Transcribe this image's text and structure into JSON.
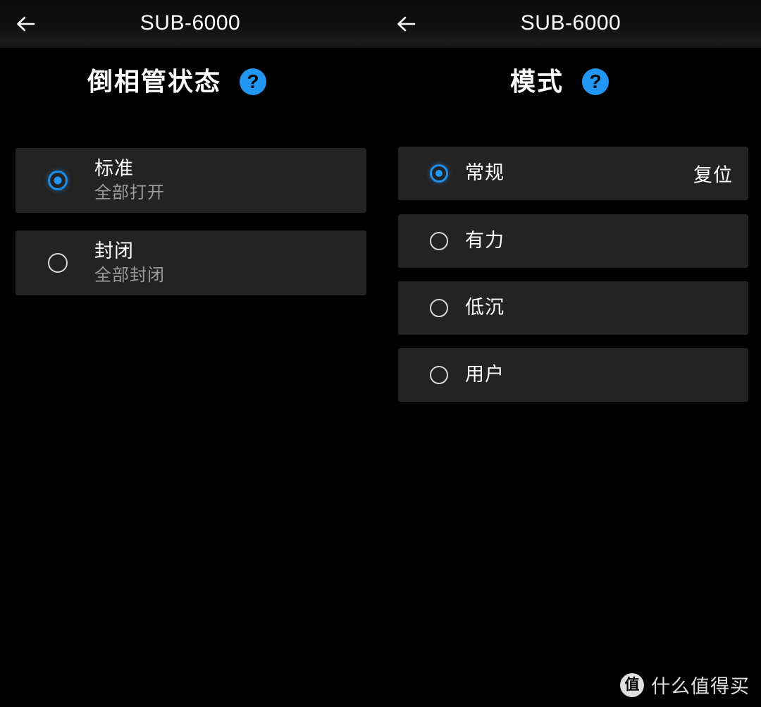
{
  "panels": [
    {
      "topbar": {
        "back_icon": "arrow-left-icon",
        "title": "SUB-6000"
      },
      "section": {
        "title": "倒相管状态",
        "help_icon": "help-circle-icon",
        "help_glyph": "?"
      },
      "options": [
        {
          "title": "标准",
          "subtitle": "全部打开",
          "selected": true
        },
        {
          "title": "封闭",
          "subtitle": "全部封闭",
          "selected": false
        }
      ]
    },
    {
      "topbar": {
        "back_icon": "arrow-left-icon",
        "title": "SUB-6000"
      },
      "section": {
        "title": "模式",
        "help_icon": "help-circle-icon",
        "help_glyph": "?"
      },
      "options": [
        {
          "title": "常规",
          "subtitle": "",
          "action": "复位",
          "selected": true
        },
        {
          "title": "有力",
          "subtitle": "",
          "selected": false
        },
        {
          "title": "低沉",
          "subtitle": "",
          "selected": false
        },
        {
          "title": "用户",
          "subtitle": "",
          "selected": false
        }
      ]
    }
  ],
  "watermark": {
    "logo_text": "值",
    "text": "什么值得买"
  },
  "colors": {
    "accent": "#2196f3",
    "card_bg": "#232323",
    "screen_bg": "#000000",
    "text_primary": "#ffffff",
    "text_secondary": "#9a9a9a"
  }
}
